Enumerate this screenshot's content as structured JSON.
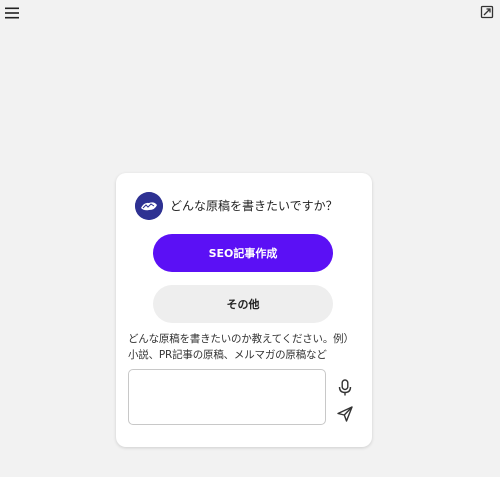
{
  "icons": {
    "menu": "hamburger-menu-icon",
    "expand": "expand-window-icon",
    "avatar": "assistant-avatar",
    "mic": "microphone-icon",
    "send": "send-icon"
  },
  "colors": {
    "background": "#f2f2f2",
    "card": "#ffffff",
    "primary_button": "#5b10f5",
    "secondary_button": "#eeeeee",
    "avatar": "#2e3192"
  },
  "chat": {
    "greeting": "どんな原稿を書きたいですか？",
    "options": {
      "primary_label": "SEO記事作成",
      "secondary_label": "その他"
    },
    "instruction": "どんな原稿を書きたいのか教えてください。例）小説、PR記事の原稿、メルマガの原稿など",
    "input": {
      "value": "",
      "placeholder": ""
    }
  }
}
